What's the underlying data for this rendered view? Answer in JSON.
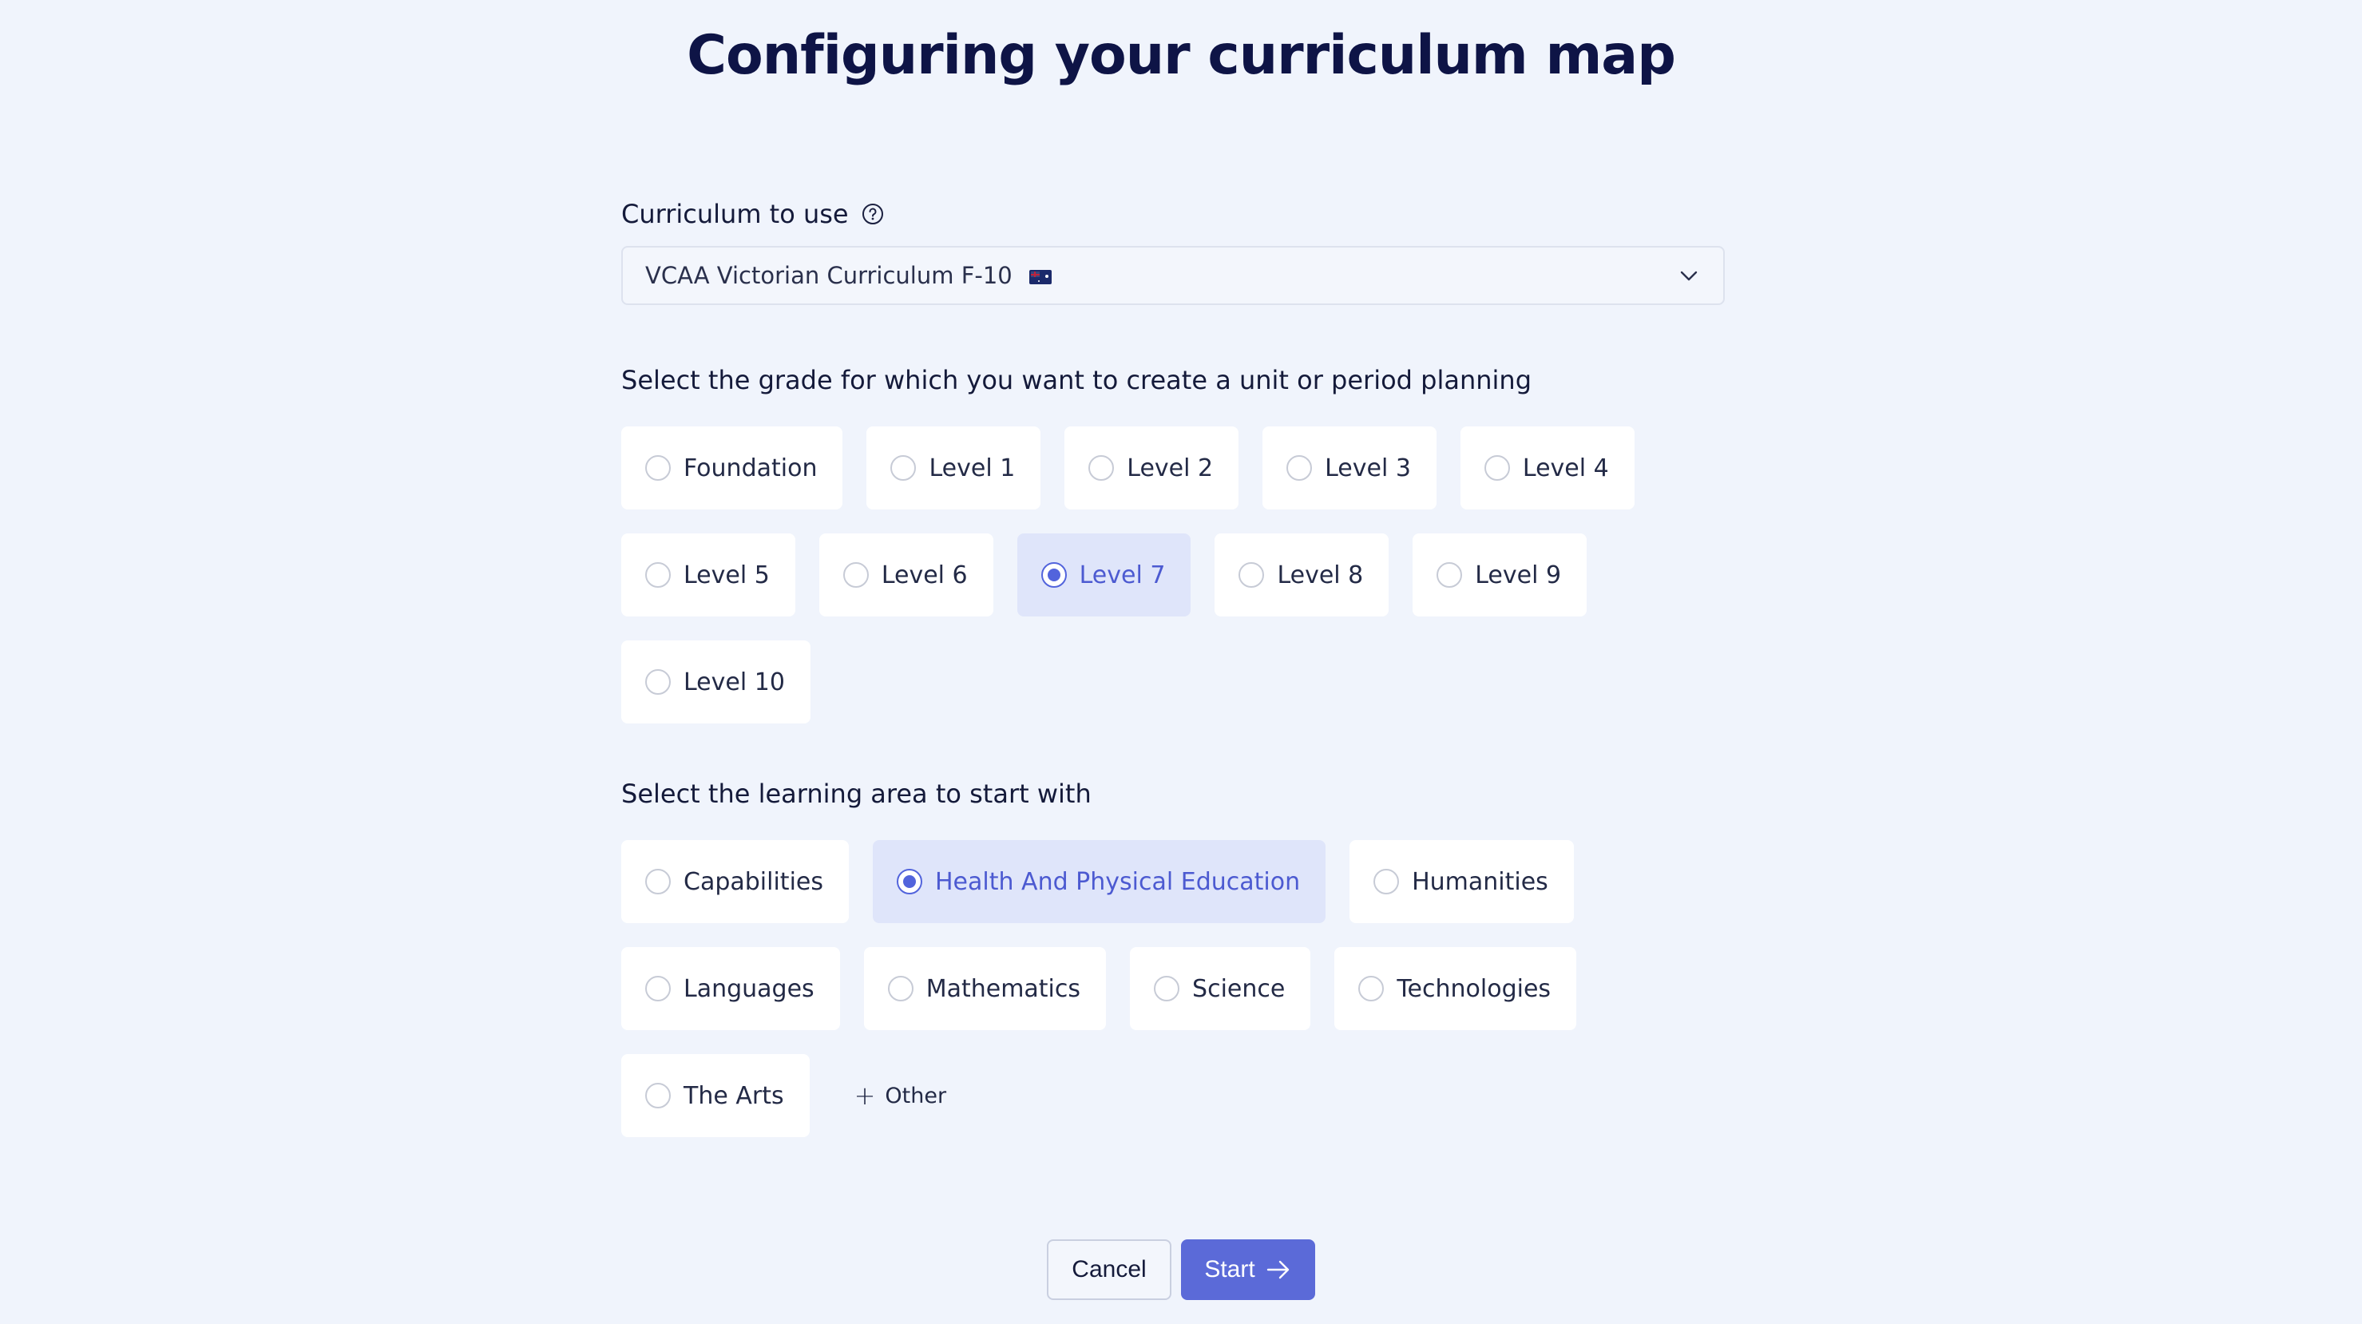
{
  "page": {
    "title": "Configuring your curriculum map"
  },
  "curriculum": {
    "label": "Curriculum to use",
    "help_icon": "question-circle-icon",
    "selected_value": "VCAA Victorian Curriculum F-10",
    "flag_icon": "australia-flag-icon",
    "chevron_icon": "chevron-down-icon"
  },
  "grade": {
    "label": "Select the grade for which you want to create a unit or period planning",
    "selected": "Level 7",
    "options": [
      "Foundation",
      "Level 1",
      "Level 2",
      "Level 3",
      "Level 4",
      "Level 5",
      "Level 6",
      "Level 7",
      "Level 8",
      "Level 9",
      "Level 10"
    ]
  },
  "learning_area": {
    "label": "Select the learning area to start with",
    "selected": "Health And Physical Education",
    "options": [
      "Capabilities",
      "Health And Physical Education",
      "Humanities",
      "Languages",
      "Mathematics",
      "Science",
      "Technologies",
      "The Arts"
    ],
    "other_label": "Other"
  },
  "actions": {
    "cancel_label": "Cancel",
    "start_label": "Start"
  },
  "colors": {
    "background": "#f0f4fc",
    "accent": "#5b6ad8",
    "selected_bg": "#dfe5fa",
    "title": "#0e1446"
  }
}
